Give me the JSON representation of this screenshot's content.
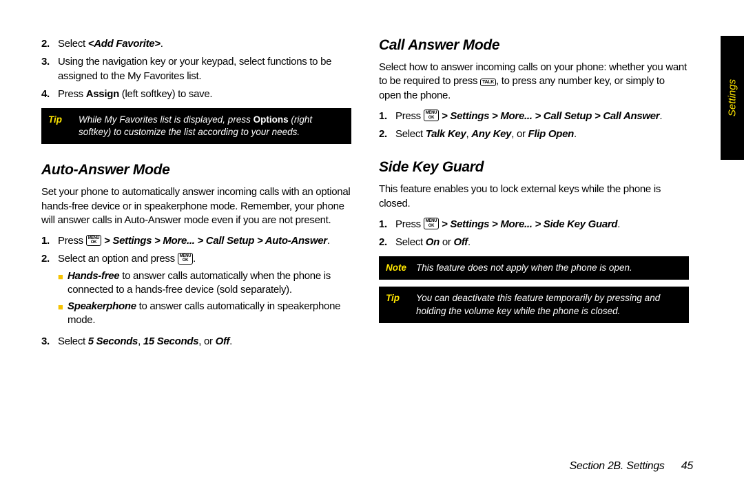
{
  "sideTab": "Settings",
  "left": {
    "step2": {
      "num": "2.",
      "pre": "Select ",
      "bi": "<Add Favorite>",
      "post": "."
    },
    "step3": {
      "num": "3.",
      "txt": "Using the navigation key or your keypad, select functions to be assigned to the My Favorites list."
    },
    "step4": {
      "num": "4.",
      "pre": "Press ",
      "b": "Assign",
      "post": " (left softkey) to save."
    },
    "tip": {
      "label": "Tip",
      "pre": "While My Favorites list is displayed, press ",
      "b": "Options",
      "post": " (right softkey) to customize the list according to your needs."
    },
    "h_auto": "Auto-Answer Mode",
    "p_auto": "Set your phone to automatically answer incoming calls with an optional hands-free device or in speakerphone mode. Remember, your phone will answer calls in Auto-Answer mode even if you are not present.",
    "auto1": {
      "num": "1.",
      "pre": "Press ",
      "key": {
        "l1": "MENU",
        "l2": "OK"
      },
      "path": " > Settings > More... > Call Setup > Auto-Answer",
      "post": "."
    },
    "auto2": {
      "num": "2.",
      "pre": "Select an option and press ",
      "key": {
        "l1": "MENU",
        "l2": "OK"
      },
      "post": "."
    },
    "auto2a": {
      "b": "Hands-free",
      "post": " to answer calls automatically when the phone is connected to a hands-free device (sold separately)."
    },
    "auto2b": {
      "b": "Speakerphone",
      "post": " to answer calls automatically in speakerphone mode."
    },
    "auto3": {
      "num": "3.",
      "pre": "Select ",
      "o1": "5 Seconds",
      "s1": ", ",
      "o2": "15 Seconds",
      "s2": ", or ",
      "o3": "Off",
      "post": "."
    }
  },
  "right": {
    "h_cam": "Call Answer Mode",
    "p_cam_pre": "Select how to answer incoming calls on your phone: whether you want to be required to press ",
    "p_cam_key": "TALK",
    "p_cam_post": ", to press any number key, or simply to open the phone.",
    "cam1": {
      "num": "1.",
      "pre": "Press ",
      "key": {
        "l1": "MENU",
        "l2": "OK"
      },
      "path": " > Settings > More... > Call Setup > Call Answer",
      "post": "."
    },
    "cam2": {
      "num": "2.",
      "pre": "Select ",
      "o1": "Talk Key",
      "s1": ", ",
      "o2": "Any Key",
      "s2": ", or ",
      "o3": "Flip Open",
      "post": "."
    },
    "h_skg": "Side Key Guard",
    "p_skg": "This feature enables you to lock external keys while the phone is closed.",
    "skg1": {
      "num": "1.",
      "pre": "Press ",
      "key": {
        "l1": "MENU",
        "l2": "OK"
      },
      "path": " > Settings > More... > Side Key Guard",
      "post": "."
    },
    "skg2": {
      "num": "2.",
      "pre": "Select ",
      "o1": "On",
      "s1": " or ",
      "o2": "Off",
      "post": "."
    },
    "note": {
      "label": "Note",
      "txt": "This feature does not apply when the phone is open."
    },
    "tip": {
      "label": "Tip",
      "txt": "You can deactivate this feature temporarily by pressing and holding the volume key while the phone is closed."
    }
  },
  "footer": {
    "section": "Section 2B. Settings",
    "page": "45"
  }
}
